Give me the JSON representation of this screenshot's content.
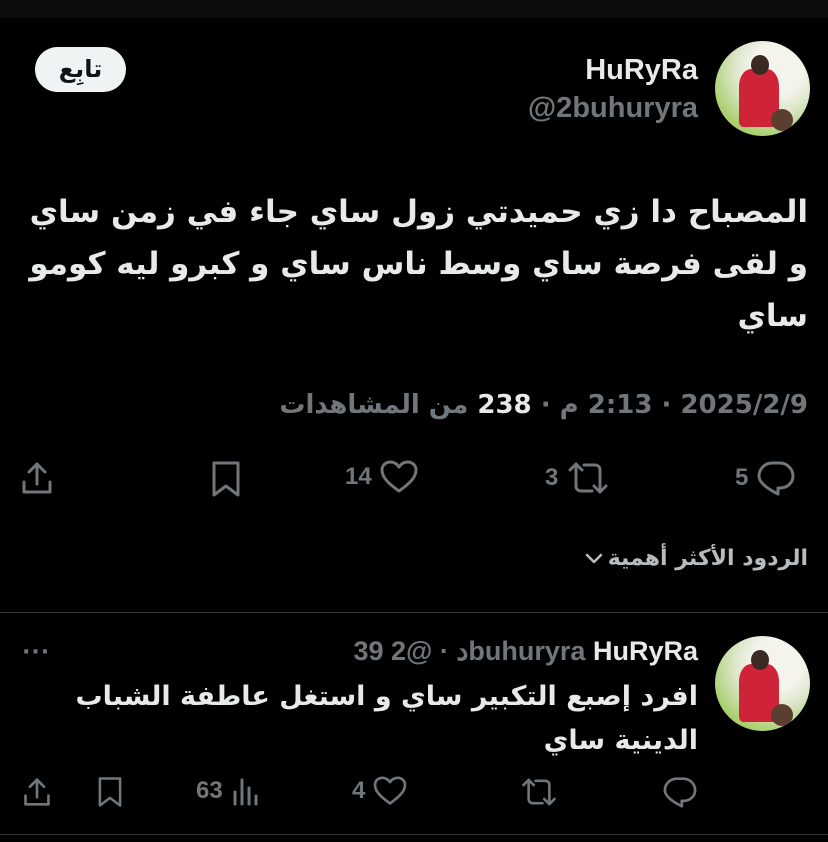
{
  "tweet": {
    "author_name": "HuRyRa",
    "author_handle": "@2buhuryra",
    "follow_label": "تابِع",
    "text": "المصباح دا زي حميدتي زول ساي جاء في زمن ساي و لقى فرصة ساي وسط ناس ساي و كبرو ليه كومو ساي",
    "date": "2025/2/9",
    "time": "2:13 م",
    "views_count": "238",
    "views_label": "من المشاهدات",
    "separator": "·",
    "replies": "5",
    "retweets": "3",
    "likes": "14"
  },
  "sort": {
    "label": "الردود الأكثر أهمية"
  },
  "reply": {
    "author_name": "HuRyRa",
    "author_handle": "@2buhuryra",
    "separator": "·",
    "time": "39 د",
    "more": "···",
    "text": "افرد إصبع التكبير ساي و استغل عاطفة الشباب الدينية ساي",
    "views": "63",
    "likes": "4"
  },
  "icons": {
    "share": "share-icon",
    "bookmark": "bookmark-icon",
    "like": "heart-icon",
    "retweet": "retweet-icon",
    "reply": "reply-icon",
    "views": "views-icon",
    "chevron": "chevron-down-icon",
    "more": "more-icon"
  },
  "colors": {
    "background": "#000000",
    "text": "#e7e9ea",
    "muted": "#71767b",
    "follow_bg": "#eff3f4"
  }
}
